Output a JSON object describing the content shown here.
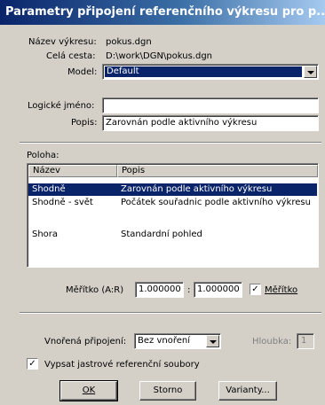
{
  "window": {
    "title": "Parametry připojení referenčního výkresu pro p..."
  },
  "fields": {
    "name_label": "Název výkresu:",
    "name_value": "pokus.dgn",
    "path_label": "Celá cesta:",
    "path_value": "D:\\work\\DGN\\pokus.dgn",
    "model_label": "Model:",
    "model_value": "Default",
    "logical_label": "Logické jméno:",
    "logical_value": "",
    "desc_label": "Popis:",
    "desc_value": "Zarovnán podle aktivního výkresu"
  },
  "orientation": {
    "group_label": "Poloha:",
    "columns": [
      "Název",
      "Popis"
    ],
    "rows": [
      {
        "name": "Shodně",
        "desc": "Zarovnán podle aktivního výkresu"
      },
      {
        "name": "Shodně - svět",
        "desc": "Počátek souřadnic podle aktivního výkresu"
      },
      {
        "name": "Shora",
        "desc": "Standardní pohled"
      }
    ]
  },
  "scale": {
    "label": "Měřítko (A:R)",
    "value_a": "1.000000",
    "separator": ":",
    "value_r": "1.000000",
    "checkbox_label": "Měřítko",
    "checked": true
  },
  "nesting": {
    "label": "Vnořená připojení:",
    "value": "Bez vnoření",
    "depth_label": "Hloubka:",
    "depth_value": "1"
  },
  "raster": {
    "checkbox_label": "Vypsat jastrové referenční soubory",
    "checked": true
  },
  "buttons": {
    "ok": "OK",
    "cancel": "Storno",
    "options": "Varianty..."
  }
}
